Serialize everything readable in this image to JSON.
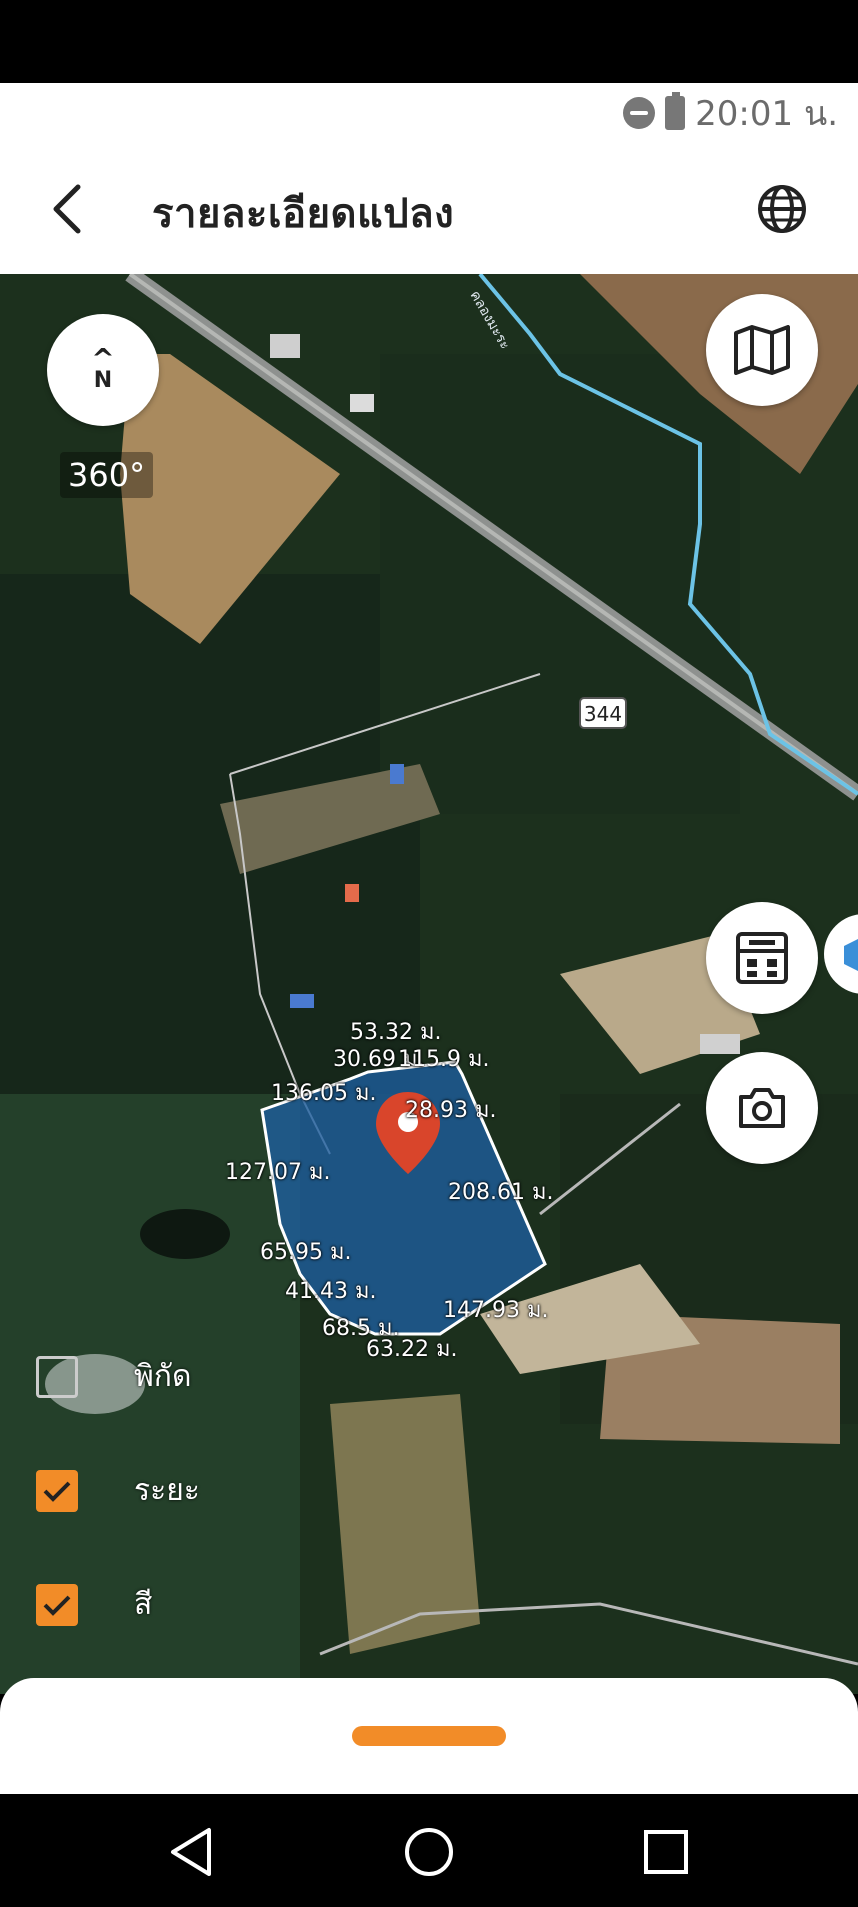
{
  "status_bar": {
    "time": "20:01 น."
  },
  "header": {
    "title": "รายละเอียดแปลง"
  },
  "compass": {
    "arrow": "^",
    "label": "N",
    "heading": "360°"
  },
  "map": {
    "road_label": "344",
    "canal_label": "คลองมะระ",
    "plot_measurements": [
      "53.32 ม.",
      "30.69 ม.",
      "115.9 ม.",
      "136.05 ม.",
      "28.93 ม.",
      "127.07 ม.",
      "208.61 ม.",
      "65.95 ม.",
      "41.43 ม.",
      "147.93 ม.",
      "68.5 ม.",
      "63.22 ม."
    ]
  },
  "legend": {
    "coordinates": {
      "label": "พิกัด",
      "checked": false
    },
    "distance": {
      "label": "ระยะ",
      "checked": true
    },
    "color": {
      "label": "สี",
      "checked": true
    }
  },
  "colors": {
    "accent": "#f28c28",
    "plot_fill": "#1d5fa0",
    "pin": "#d9452b"
  }
}
